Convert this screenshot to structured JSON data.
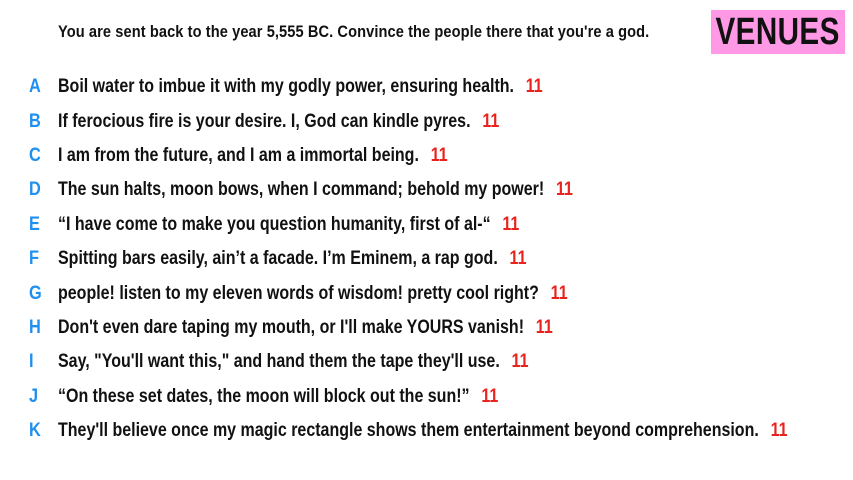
{
  "prompt": "You are sent back to the year 5,555 BC. Convince the people there that you're a god.",
  "badge": {
    "label": "VENUES",
    "color": "#ff99e6"
  },
  "colors": {
    "letter": "#1f8ff0",
    "score": "#e8231d",
    "text": "#111111"
  },
  "answers": [
    {
      "letter": "A",
      "text": "Boil water to imbue it with my godly power, ensuring health.",
      "score": "11"
    },
    {
      "letter": "B",
      "text": "If ferocious fire is your desire. I, God can kindle pyres.",
      "score": "11"
    },
    {
      "letter": "C",
      "text": "I am from the future, and I am a immortal being.",
      "score": "11"
    },
    {
      "letter": "D",
      "text": "The sun halts, moon bows, when I command; behold my power!",
      "score": "11"
    },
    {
      "letter": "E",
      "text": "“I have come to make you question humanity, first of al-“",
      "score": "11"
    },
    {
      "letter": "F",
      "text": "Spitting bars easily, ain’t a facade. I’m Eminem, a rap god.",
      "score": "11"
    },
    {
      "letter": "G",
      "text": "people! listen to my eleven words of wisdom! pretty cool right?",
      "score": "11"
    },
    {
      "letter": "H",
      "text": "Don't even dare taping my mouth, or I'll make YOURS vanish!",
      "score": "11"
    },
    {
      "letter": "I",
      "text": "Say, \"You'll want this,\" and hand them the tape they'll use.",
      "score": "11"
    },
    {
      "letter": "J",
      "text": "“On these set dates, the moon will block out the sun!”",
      "score": "11"
    },
    {
      "letter": "K",
      "text": "They'll believe once my magic rectangle shows them entertainment beyond comprehension.",
      "score": "11"
    }
  ]
}
